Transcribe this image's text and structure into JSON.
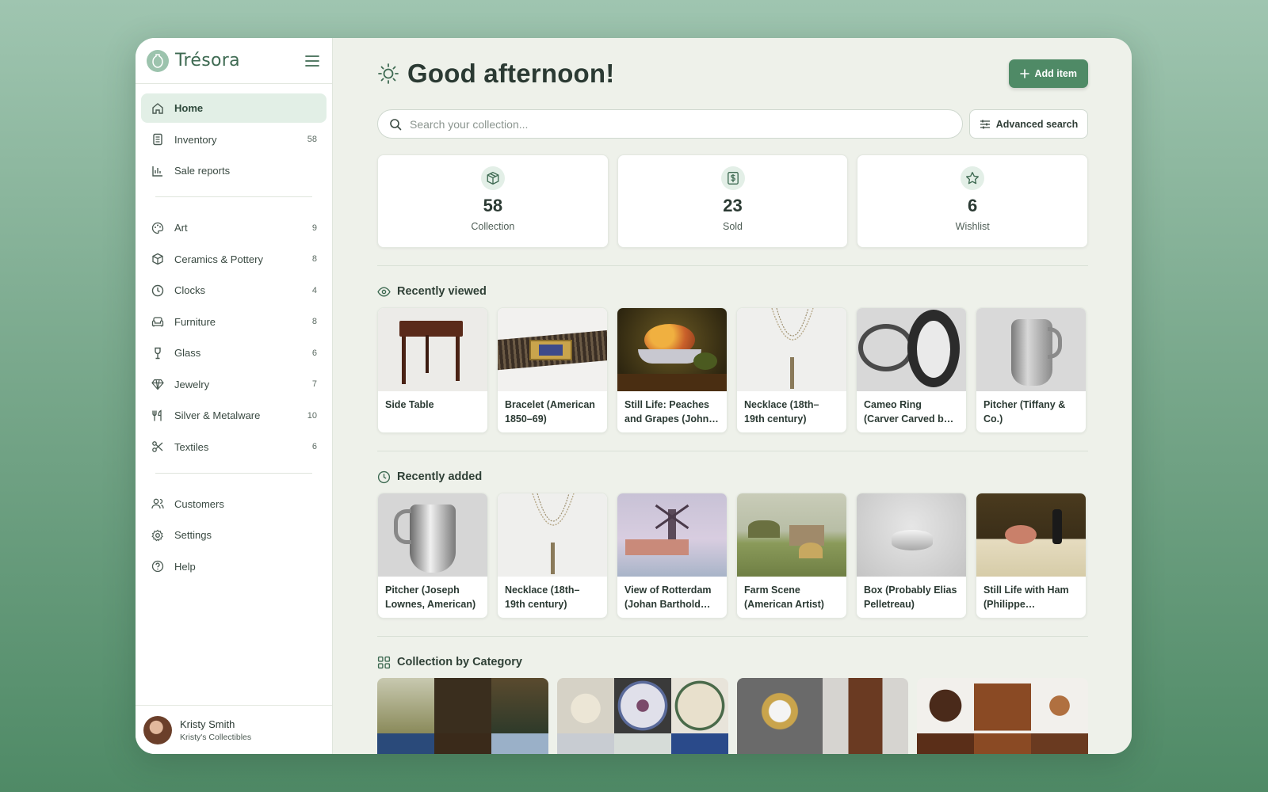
{
  "brand": {
    "name": "Trésora"
  },
  "nav": {
    "primary": [
      {
        "label": "Home",
        "icon": "home-icon",
        "active": true
      },
      {
        "label": "Inventory",
        "icon": "inventory-icon",
        "count": "58"
      },
      {
        "label": "Sale reports",
        "icon": "bar-chart-icon"
      }
    ],
    "categories": [
      {
        "label": "Art",
        "icon": "palette-icon",
        "count": "9"
      },
      {
        "label": "Ceramics & Pottery",
        "icon": "cube-icon",
        "count": "8"
      },
      {
        "label": "Clocks",
        "icon": "clock-icon",
        "count": "4"
      },
      {
        "label": "Furniture",
        "icon": "sofa-icon",
        "count": "8"
      },
      {
        "label": "Glass",
        "icon": "wine-glass-icon",
        "count": "6"
      },
      {
        "label": "Jewelry",
        "icon": "diamond-icon",
        "count": "7"
      },
      {
        "label": "Silver & Metalware",
        "icon": "utensils-icon",
        "count": "10"
      },
      {
        "label": "Textiles",
        "icon": "scissors-icon",
        "count": "6"
      }
    ],
    "secondary": [
      {
        "label": "Customers",
        "icon": "users-icon"
      },
      {
        "label": "Settings",
        "icon": "gear-icon"
      },
      {
        "label": "Help",
        "icon": "help-icon"
      }
    ]
  },
  "user": {
    "name": "Kristy Smith",
    "subtitle": "Kristy's Collectibles"
  },
  "header": {
    "greeting": "Good afternoon!",
    "add_label": "Add item"
  },
  "search": {
    "placeholder": "Search your collection...",
    "advanced_label": "Advanced search"
  },
  "stats": [
    {
      "value": "58",
      "label": "Collection",
      "icon": "box-icon"
    },
    {
      "value": "23",
      "label": "Sold",
      "icon": "dollar-icon"
    },
    {
      "value": "6",
      "label": "Wishlist",
      "icon": "star-icon"
    }
  ],
  "recently_viewed": {
    "title": "Recently viewed",
    "items": [
      {
        "title": "Side Table"
      },
      {
        "title": "Bracelet (American 1850–69)"
      },
      {
        "title": "Still Life: Peaches and Grapes (John Francis)"
      },
      {
        "title": "Necklace (18th–19th century)"
      },
      {
        "title": "Cameo Ring (Carver Carved by William Bell)"
      },
      {
        "title": "Pitcher (Tiffany & Co.)"
      }
    ]
  },
  "recently_added": {
    "title": "Recently added",
    "items": [
      {
        "title": "Pitcher (Joseph Lownes, American)"
      },
      {
        "title": "Necklace (18th–19th century)"
      },
      {
        "title": "View of Rotterdam (Johan Barthold Jongkind)"
      },
      {
        "title": "Farm Scene (American Artist)"
      },
      {
        "title": "Box (Probably Elias Pelletreau)"
      },
      {
        "title": "Still Life with Ham (Philippe Rousseau)"
      }
    ]
  },
  "by_category": {
    "title": "Collection by Category"
  },
  "colors": {
    "accent": "#4f8a66",
    "active_nav": "#e2efe6",
    "panel": "#eef1ea"
  }
}
